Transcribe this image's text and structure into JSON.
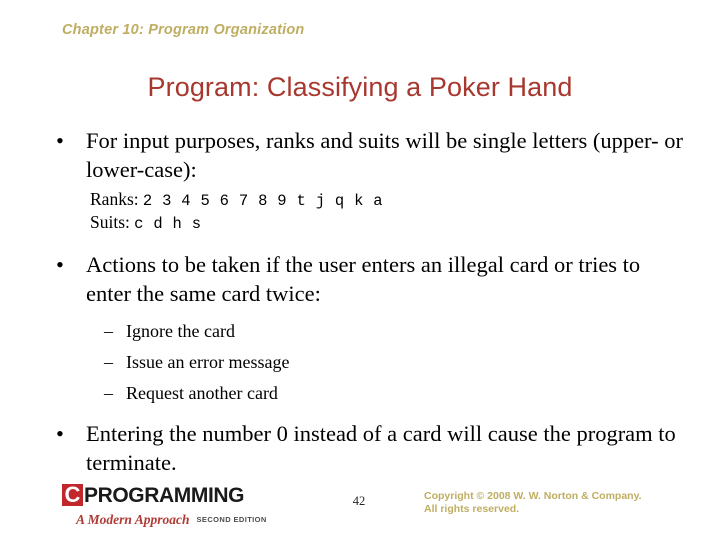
{
  "slide": {
    "chapter_header": "Chapter 10: Program Organization",
    "title": "Program: Classifying a Poker Hand",
    "bullets": [
      {
        "marker": "•",
        "text": "For input purposes, ranks and suits will be single letters (upper- or lower-case):"
      },
      {
        "marker": "•",
        "text": "Actions to be taken if the user enters an illegal card or tries to enter the same card twice:"
      },
      {
        "marker": "•",
        "text": "Entering the number 0 instead of a card will cause the program to terminate."
      }
    ],
    "code_block": {
      "ranks_label": "Ranks:",
      "ranks_values": "2 3 4 5 6 7 8 9 t j q k a",
      "suits_label": "Suits:",
      "suits_values": "c d h s"
    },
    "sub_bullets": [
      {
        "marker": "–",
        "text": "Ignore the card"
      },
      {
        "marker": "–",
        "text": "Issue an error message"
      },
      {
        "marker": "–",
        "text": "Request another card"
      }
    ]
  },
  "footer": {
    "logo": {
      "c_letter": "C",
      "wordmark": "PROGRAMMING",
      "subtitle": "A Modern Approach",
      "edition": "SECOND EDITION"
    },
    "page_number": "42",
    "copyright_line1": "Copyright © 2008 W. W. Norton & Company.",
    "copyright_line2": "All rights reserved."
  },
  "colors": {
    "header_khaki": "#bfae62",
    "title_red": "#a8382f",
    "logo_red": "#c1272d",
    "body_black": "#000000"
  }
}
